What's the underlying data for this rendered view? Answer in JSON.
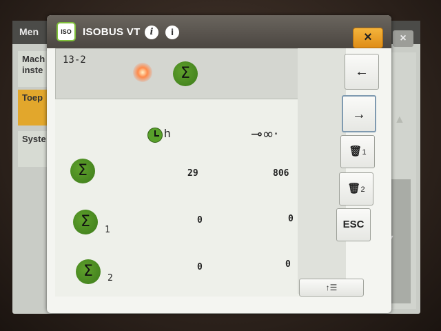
{
  "background_screen": {
    "title": "Men",
    "close_label": "×",
    "tabs": [
      "Mach inste",
      "Toep",
      "Syste"
    ]
  },
  "dialog": {
    "logo_text": "ISO",
    "title": "ISOBUS VT",
    "info_label": "i",
    "info2_label": "i",
    "close_label": "×",
    "row_id": "13-2",
    "header": {
      "time_unit": "h"
    },
    "rows": [
      {
        "sub": "",
        "hours": "29",
        "distance": "806"
      },
      {
        "sub": "1",
        "hours": "0",
        "distance": "0"
      },
      {
        "sub": "2",
        "hours": "0",
        "distance": "0"
      }
    ],
    "softkeys": {
      "back": "←",
      "next": "→",
      "delete1_sub": "1",
      "delete2_sub": "2",
      "esc": "ESC"
    },
    "bottom_button": "↑☰"
  },
  "colors": {
    "accent_orange": "#e2a72c",
    "sigma_green": "#4c8f22"
  }
}
